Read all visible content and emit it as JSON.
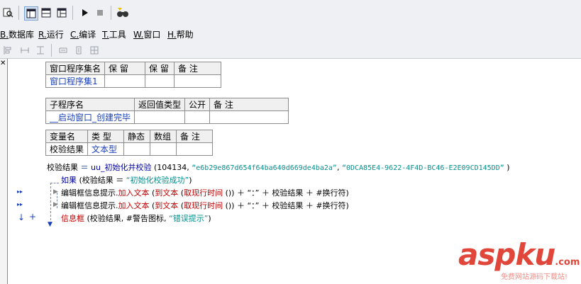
{
  "menu": [
    {
      "key": "B.",
      "label": "数据库"
    },
    {
      "key": "R.",
      "label": "运行"
    },
    {
      "key": "C.",
      "label": "编译"
    },
    {
      "key": "T.",
      "label": "工具"
    },
    {
      "key": "W.",
      "label": "窗口"
    },
    {
      "key": "H.",
      "label": "帮助"
    }
  ],
  "icons": {
    "toolbar1": [
      "find-icon",
      "layout-icon",
      "split-horizontal-icon",
      "split-vertical-icon",
      "run-icon",
      "stop-icon",
      "debug-icon"
    ],
    "toolbar2": [
      "align-left-icon",
      "align-center-icon",
      "align-top-icon",
      "same-width-icon",
      "same-height-icon",
      "center-icon"
    ]
  },
  "table1": {
    "headers": [
      "窗口程序集名",
      "保 留",
      "保 留",
      "备 注"
    ],
    "row": [
      "窗口程序集1",
      "",
      "",
      ""
    ]
  },
  "table2": {
    "headers": [
      "子程序名",
      "返回值类型",
      "公开",
      "备 注"
    ],
    "row": [
      "__启动窗口_创建完毕",
      "",
      "",
      ""
    ]
  },
  "table3": {
    "headers": [
      "变量名",
      "类 型",
      "静态",
      "数组",
      "备 注"
    ],
    "row": [
      "校验结果",
      "文本型",
      "",
      "",
      ""
    ]
  },
  "code": {
    "line1": {
      "var": "校验结果",
      "eq": " ＝ ",
      "func": "uu_初始化并校验",
      "args_open": " (",
      "arg1": "104134",
      "sep1": ", ",
      "arg2": "“e6b29e867d654f64ba640d669de4ba2a”",
      "sep2": ", ",
      "arg3": "“0DCA85E4-9622-4F4D-BC46-E2E09CD145DD”",
      "close": " )"
    },
    "line2": {
      "kw": "如果",
      "open": " (",
      "var": "校验结果",
      "eq": " ＝ ",
      "str": "“初始化校验成功”",
      "close": ")"
    },
    "line3": {
      "obj": "编辑框信息提示.",
      "method": "加入文本",
      "open": " (",
      "f1": "到文本",
      "o1": " (",
      "f2": "取现行时间",
      "rest": " ()) ＋ “：” ＋ 校验结果 ＋ #换行符)"
    },
    "line4": {
      "obj": "编辑框信息提示.",
      "method": "加入文本",
      "open": " (",
      "f1": "到文本",
      "o1": " (",
      "f2": "取现行时间",
      "rest": " ()) ＋ “：” ＋ 校验结果 ＋ #换行符)"
    },
    "line5": {
      "func": "信息框",
      "open": " (",
      "var": "校验结果",
      "sep": ", ",
      "const": "#警告图标",
      "sep2": ", ",
      "str": "“错误提示”",
      "close": ")"
    }
  },
  "watermark": {
    "brand": "aspku",
    "tld": ".com",
    "tagline": "免费网站源码下载站!"
  }
}
